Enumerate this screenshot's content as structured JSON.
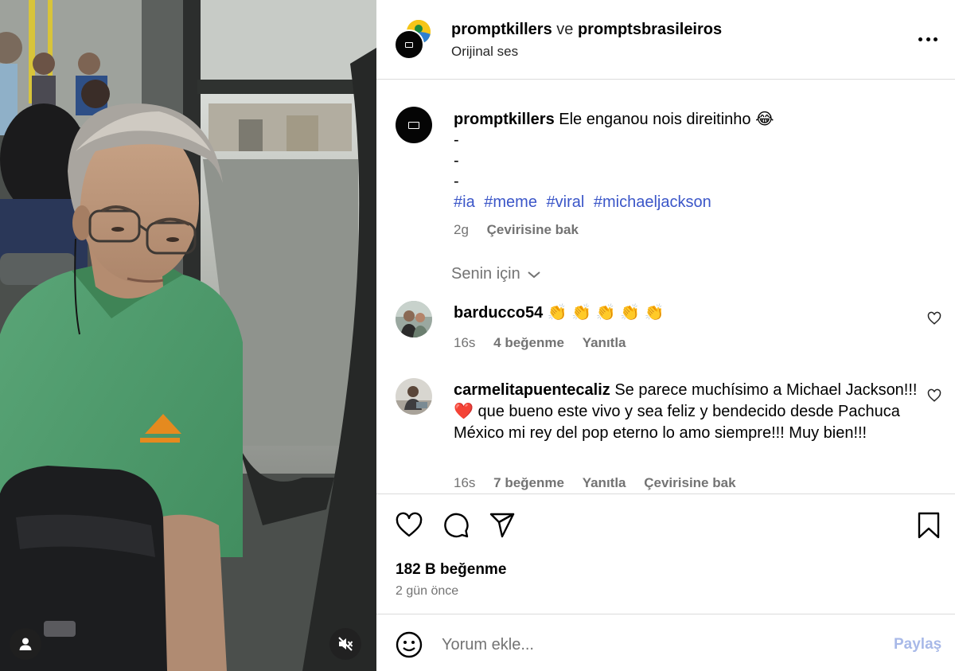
{
  "post_header": {
    "author": "promptkillers",
    "connector": "ve",
    "collaborator": "promptsbrasileiros",
    "audio": "Orijinal ses"
  },
  "caption": {
    "username": "promptkillers",
    "text": "Ele enganou nois direitinho 😂",
    "dash_lines": [
      "-",
      "-",
      "-"
    ],
    "hashtags": [
      "#ia",
      "#meme",
      "#viral",
      "#michaeljackson"
    ],
    "time": "2g",
    "see_translation": "Çevirisine bak"
  },
  "comments_filter": "Senin için",
  "comments": [
    {
      "username": "barducco54",
      "text": "👏 👏 👏 👏 👏",
      "time": "16s",
      "likes": "4 beğenme",
      "reply": "Yanıtla",
      "translate": ""
    },
    {
      "username": "carmelitapuentecaliz",
      "text": "Se parece muchísimo a Michael Jackson!!! ❤️  que bueno este vivo y sea feliz y bendecido desde Pachuca México mi rey del pop eterno lo amo siempre!!! Muy bien!!!",
      "time": "16s",
      "likes": "7 beğenme",
      "reply": "Yanıtla",
      "translate": "Çevirisine bak"
    }
  ],
  "actions": {
    "like_icon": "heart-icon",
    "comment_icon": "comment-bubble-icon",
    "share_icon": "paper-plane-icon",
    "save_icon": "bookmark-icon"
  },
  "stats": {
    "likes": "182 B beğenme",
    "posted": "2 gün önce"
  },
  "composer": {
    "placeholder": "Yorum ekle...",
    "post_label": "Paylaş"
  },
  "media": {
    "user_icon": "user-tag-icon",
    "mute_icon": "speaker-muted-icon"
  },
  "colors": {
    "hashtag": "#3b56c8",
    "muted_text": "#737373",
    "post_button_disabled": "#a8b9e8",
    "border": "#dbdbdb",
    "shirt": "#4a9a6a"
  }
}
